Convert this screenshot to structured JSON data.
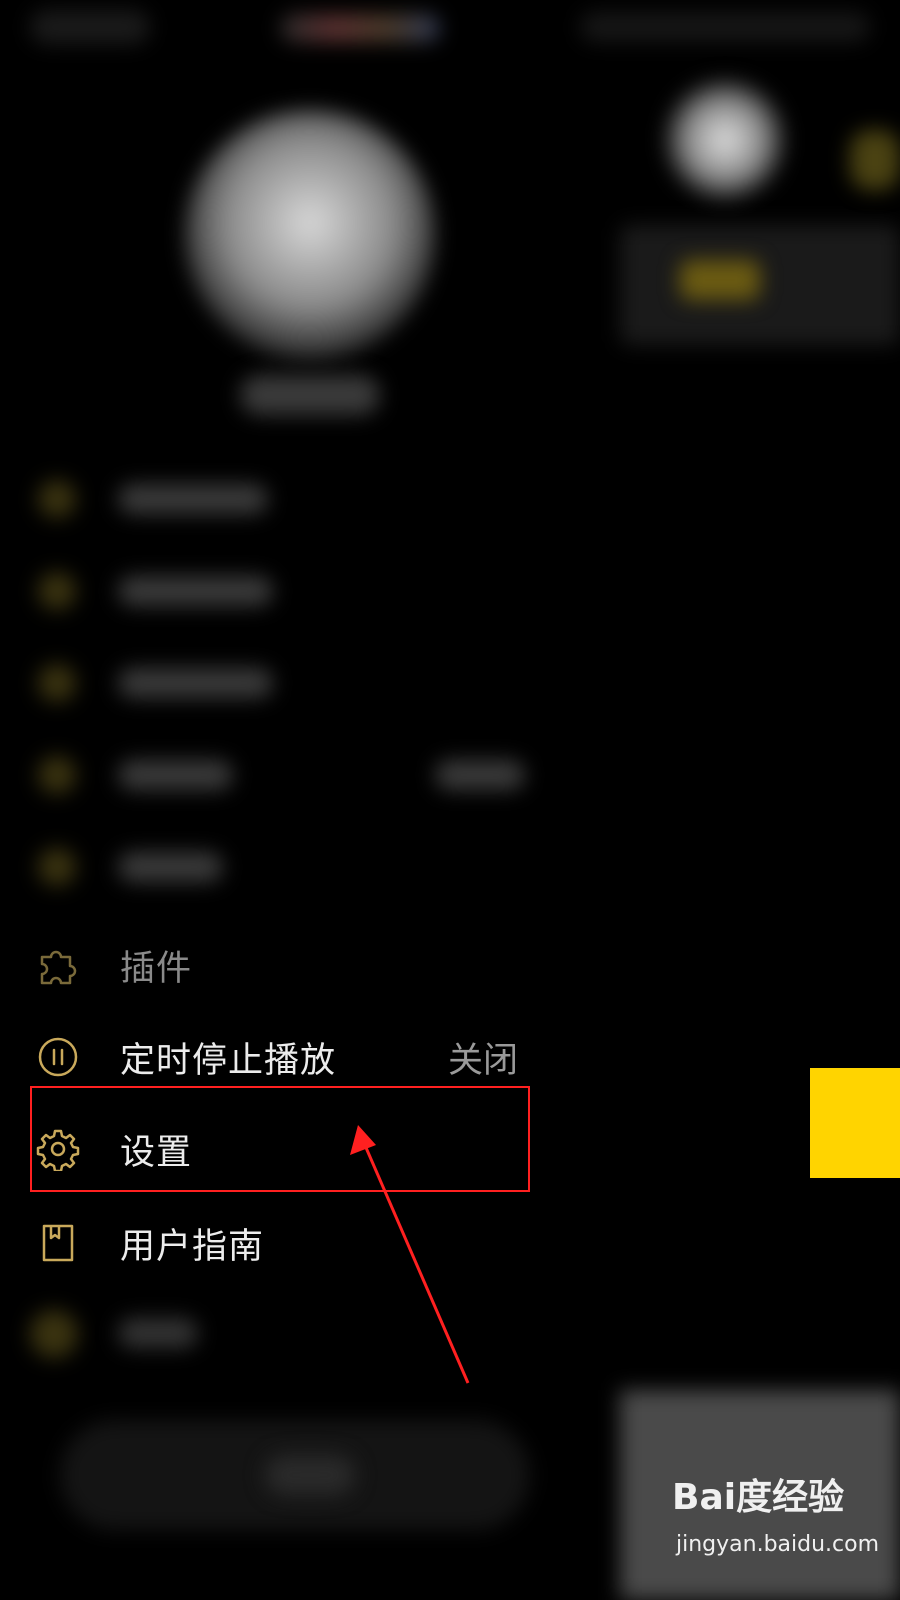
{
  "menu": {
    "plugins_label": "插件",
    "sleep_timer_label": "定时停止播放",
    "sleep_timer_value": "关闭",
    "settings_label": "设置",
    "user_guide_label": "用户指南"
  },
  "accent_color": "#ffd400",
  "icon_color": "#c9a95b",
  "highlight_color": "#ff2020",
  "watermark": {
    "logo_text": "Bai度经验",
    "url": "jingyan.baidu.com"
  }
}
